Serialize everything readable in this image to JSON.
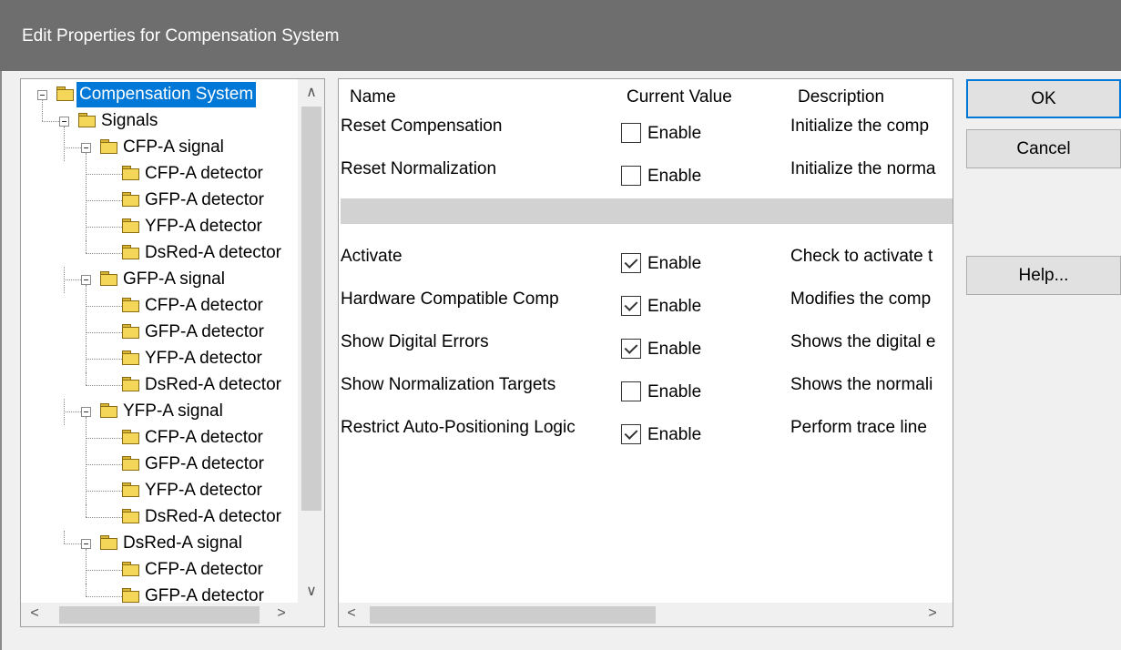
{
  "window": {
    "title": "Edit Properties for Compensation System"
  },
  "tree": {
    "items": [
      {
        "label": "Compensation System",
        "level": 0,
        "expanded": true,
        "selected": true
      },
      {
        "label": "Signals",
        "level": 1,
        "expanded": true
      },
      {
        "label": "CFP-A signal",
        "level": 2,
        "expanded": true
      },
      {
        "label": "CFP-A detector",
        "level": 3
      },
      {
        "label": "GFP-A detector",
        "level": 3
      },
      {
        "label": "YFP-A detector",
        "level": 3
      },
      {
        "label": "DsRed-A detector",
        "level": 3
      },
      {
        "label": "GFP-A signal",
        "level": 2,
        "expanded": true
      },
      {
        "label": "CFP-A detector",
        "level": 3
      },
      {
        "label": "GFP-A detector",
        "level": 3
      },
      {
        "label": "YFP-A detector",
        "level": 3
      },
      {
        "label": "DsRed-A detector",
        "level": 3
      },
      {
        "label": "YFP-A signal",
        "level": 2,
        "expanded": true
      },
      {
        "label": "CFP-A detector",
        "level": 3
      },
      {
        "label": "GFP-A detector",
        "level": 3
      },
      {
        "label": "YFP-A detector",
        "level": 3
      },
      {
        "label": "DsRed-A detector",
        "level": 3
      },
      {
        "label": "DsRed-A signal",
        "level": 2,
        "expanded": true
      },
      {
        "label": "CFP-A detector",
        "level": 3
      },
      {
        "label": "GFP-A detector",
        "level": 3
      }
    ]
  },
  "properties": {
    "headers": {
      "name": "Name",
      "value": "Current Value",
      "description": "Description"
    },
    "rows": [
      {
        "name": "Reset Compensation",
        "value_label": "Enable",
        "checked": false,
        "description": "Initialize the comp"
      },
      {
        "name": "Reset Normalization",
        "value_label": "Enable",
        "checked": false,
        "description": "Initialize the norma"
      },
      {
        "name": "Activate",
        "value_label": "Enable",
        "checked": true,
        "description": "Check to activate t"
      },
      {
        "name": "Hardware Compatible Comp",
        "value_label": "Enable",
        "checked": true,
        "description": "Modifies the comp"
      },
      {
        "name": "Show Digital Errors",
        "value_label": "Enable",
        "checked": true,
        "description": "Shows the digital e"
      },
      {
        "name": "Show Normalization Targets",
        "value_label": "Enable",
        "checked": false,
        "description": "Shows the normali"
      },
      {
        "name": "Restrict Auto-Positioning Logic",
        "value_label": "Enable",
        "checked": true,
        "description": "Perform trace line"
      }
    ]
  },
  "buttons": {
    "ok": "OK",
    "cancel": "Cancel",
    "help": "Help..."
  },
  "scroll_glyphs": {
    "up": "∧",
    "down": "∨",
    "left": "<",
    "right": ">"
  },
  "colors": {
    "titlebar": "#6e6e6e",
    "selection": "#0078d7",
    "folder": "#f4d659"
  }
}
